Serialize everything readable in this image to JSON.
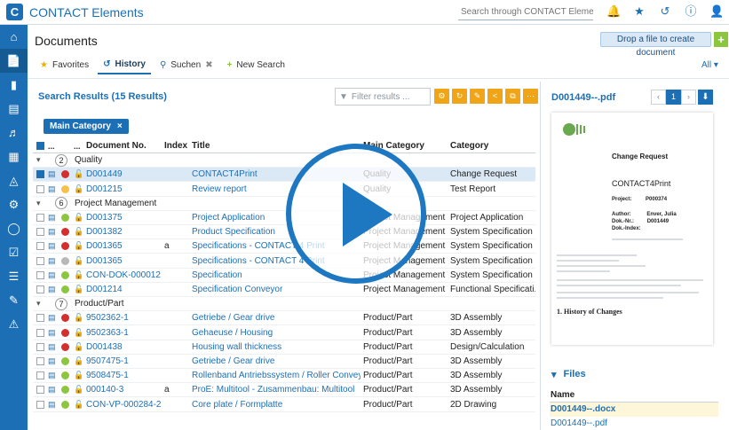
{
  "app": {
    "logo_letter": "C",
    "title": "CONTACT Elements"
  },
  "global_search": {
    "placeholder": "Search through CONTACT Elements ..."
  },
  "page": {
    "title": "Documents",
    "drop_label": "Drop a file to create document",
    "plus": "+"
  },
  "tabs": [
    {
      "label": "Favorites",
      "icon": "star-icon"
    },
    {
      "label": "History",
      "icon": "history-icon"
    },
    {
      "label": "Suchen",
      "icon": "search-icon"
    },
    {
      "label": "New Search",
      "icon": "plus-icon"
    }
  ],
  "all_filter": "All",
  "results": {
    "title": "Search Results (15 Results)",
    "filter_placeholder": "Filter results ...",
    "chip": "Main Category",
    "chip_close": "×",
    "columns": {
      "no": "Document No.",
      "index": "Index",
      "title": "Title",
      "main": "Main Category",
      "category": "Category"
    },
    "groups": [
      {
        "count": "2",
        "label": "Quality",
        "rows": [
          {
            "no": "D001449",
            "index": "",
            "title": "CONTACT4Print",
            "main": "Quality",
            "category": "Change Request",
            "status": "#d32f2f",
            "checked": true
          },
          {
            "no": "D001215",
            "index": "",
            "title": "Review report",
            "main": "Quality",
            "category": "Test Report",
            "status": "#f6c04a",
            "checked": false
          }
        ]
      },
      {
        "count": "6",
        "label": "Project Management",
        "rows": [
          {
            "no": "D001375",
            "index": "",
            "title": "Project Application",
            "main": "Project Management",
            "category": "Project Application",
            "status": "#8cc63f"
          },
          {
            "no": "D001382",
            "index": "",
            "title": "Product Specification",
            "main": "Project Management",
            "category": "System Specification",
            "status": "#d32f2f"
          },
          {
            "no": "D001365",
            "index": "a",
            "title": "Specifications - CONTACT 4 Print",
            "main": "Project Management",
            "category": "System Specification",
            "status": "#d32f2f"
          },
          {
            "no": "D001365",
            "index": "",
            "title": "Specifications - CONTACT 4 Print",
            "main": "Project Management",
            "category": "System Specification",
            "status": "#b8b8b8"
          },
          {
            "no": "CON-DOK-000012",
            "index": "",
            "title": "Specification",
            "main": "Project Management",
            "category": "System Specification",
            "status": "#8cc63f"
          },
          {
            "no": "D001214",
            "index": "",
            "title": "Specification Conveyor",
            "main": "Project Management",
            "category": "Functional Specificati...",
            "status": "#8cc63f"
          }
        ]
      },
      {
        "count": "7",
        "label": "Product/Part",
        "rows": [
          {
            "no": "9502362-1",
            "index": "",
            "title": "Getriebe / Gear drive",
            "main": "Product/Part",
            "category": "3D Assembly",
            "status": "#d32f2f"
          },
          {
            "no": "9502363-1",
            "index": "",
            "title": "Gehaeuse / Housing",
            "main": "Product/Part",
            "category": "3D Assembly",
            "status": "#d32f2f"
          },
          {
            "no": "D001438",
            "index": "",
            "title": "Housing wall thickness",
            "main": "Product/Part",
            "category": "Design/Calculation",
            "status": "#d32f2f"
          },
          {
            "no": "9507475-1",
            "index": "",
            "title": "Getriebe / Gear drive",
            "main": "Product/Part",
            "category": "3D Assembly",
            "status": "#8cc63f"
          },
          {
            "no": "9508475-1",
            "index": "",
            "title": "Rollenband Antriebssystem / Roller Conveyor ...",
            "main": "Product/Part",
            "category": "3D Assembly",
            "status": "#8cc63f"
          },
          {
            "no": "000140-3",
            "index": "a",
            "title": "ProE: Multitool - Zusammenbau: Multitool",
            "main": "Product/Part",
            "category": "3D Assembly",
            "status": "#8cc63f"
          },
          {
            "no": "CON-VP-000284-2",
            "index": "",
            "title": "Core plate / Formplatte",
            "main": "Product/Part",
            "category": "2D Drawing",
            "status": "#8cc63f"
          }
        ]
      }
    ]
  },
  "preview": {
    "title": "D001449--.pdf",
    "page": "1",
    "doc": {
      "heading": "Change Request",
      "product": "CONTACT4Print",
      "project_label": "Project:",
      "project_value": "P000374",
      "author_label": "Author:",
      "author_value": "Enver, Julia",
      "docno_label": "Dok.-Nr.:",
      "docno_value": "D001449",
      "docindex_label": "Dok.-Index:",
      "history": "1. History of Changes"
    }
  },
  "files": {
    "title": "Files",
    "col_name": "Name",
    "items": [
      "D001449--.docx",
      "D001449--.pdf"
    ]
  },
  "colors": {
    "brand": "#1d6fb5",
    "accent_orange": "#f0a518",
    "accent_green": "#8cc63f"
  }
}
